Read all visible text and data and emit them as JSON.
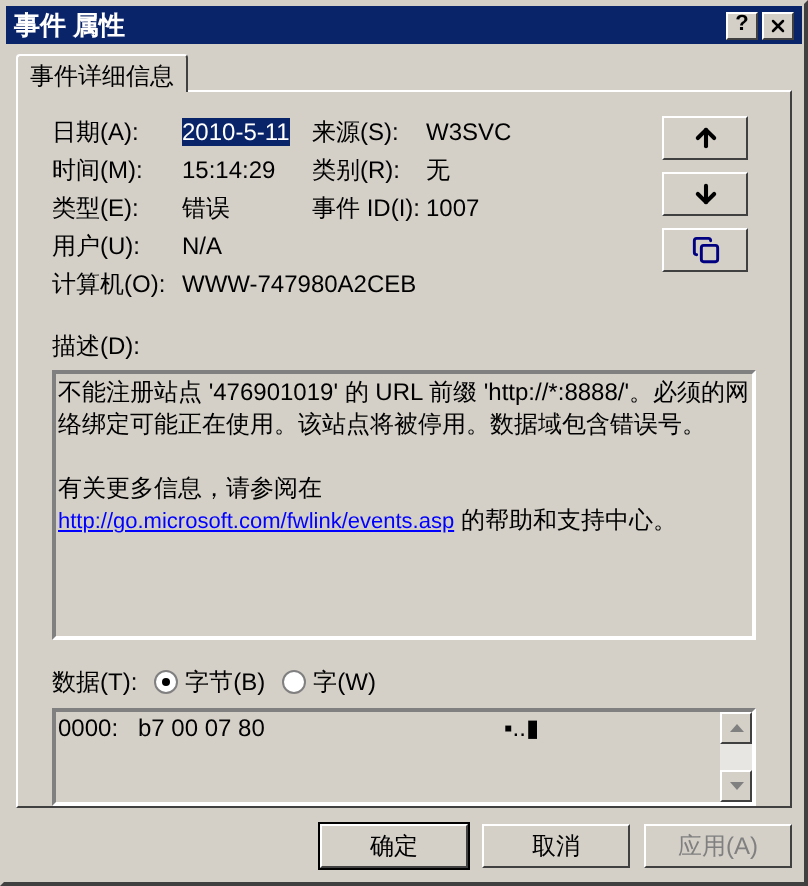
{
  "window": {
    "title": "事件 属性",
    "help_button": "?"
  },
  "tabs": [
    {
      "label": "事件详细信息",
      "selected": true
    }
  ],
  "fields": [
    {
      "label": "日期(A):",
      "value": "2010-5-11",
      "selected": true
    },
    {
      "label": "来源(S):",
      "value": "W3SVC",
      "selected": false
    },
    {
      "label": "时间(M):",
      "value": "15:14:29",
      "selected": false
    },
    {
      "label": "类别(R):",
      "value": "无",
      "selected": false
    },
    {
      "label": "类型(E):",
      "value": "错误",
      "selected": false
    },
    {
      "label": "事件 ID(I):",
      "value": "1007",
      "selected": false
    },
    {
      "label": "用户(U):",
      "value": "N/A",
      "selected": false
    },
    {
      "label": "计算机(O):",
      "value": "WWW-747980A2CEB",
      "selected": false
    }
  ],
  "side_buttons": [
    {
      "kind": "up"
    },
    {
      "kind": "down"
    },
    {
      "kind": "copy"
    }
  ],
  "description": {
    "label": "描述(D):",
    "paragraphs": [
      {
        "text": "不能注册站点 '476901019' 的 URL 前缀 'http://*:8888/'。必须的网络绑定可能正在使用。该站点将被停用。数据域包含错误号。"
      },
      {
        "text": "有关更多信息，请参阅在",
        "link": "http://go.microsoft.com/fwlink/events.asp",
        "after": "的帮助和支持中心。"
      }
    ]
  },
  "data": {
    "label": "数据(T):",
    "options": [
      {
        "label": "字节(B)",
        "selected": true
      },
      {
        "label": "字(W)",
        "selected": false
      }
    ],
    "lines": [
      {
        "offset": "0000:",
        "bytes": "b7 00 07 80",
        "ascii": "▪..▮"
      }
    ]
  },
  "buttons": [
    {
      "label": "确定",
      "default": true,
      "disabled": false
    },
    {
      "label": "取消",
      "default": false,
      "disabled": false
    },
    {
      "label": "应用(A)",
      "default": false,
      "disabled": true
    }
  ]
}
